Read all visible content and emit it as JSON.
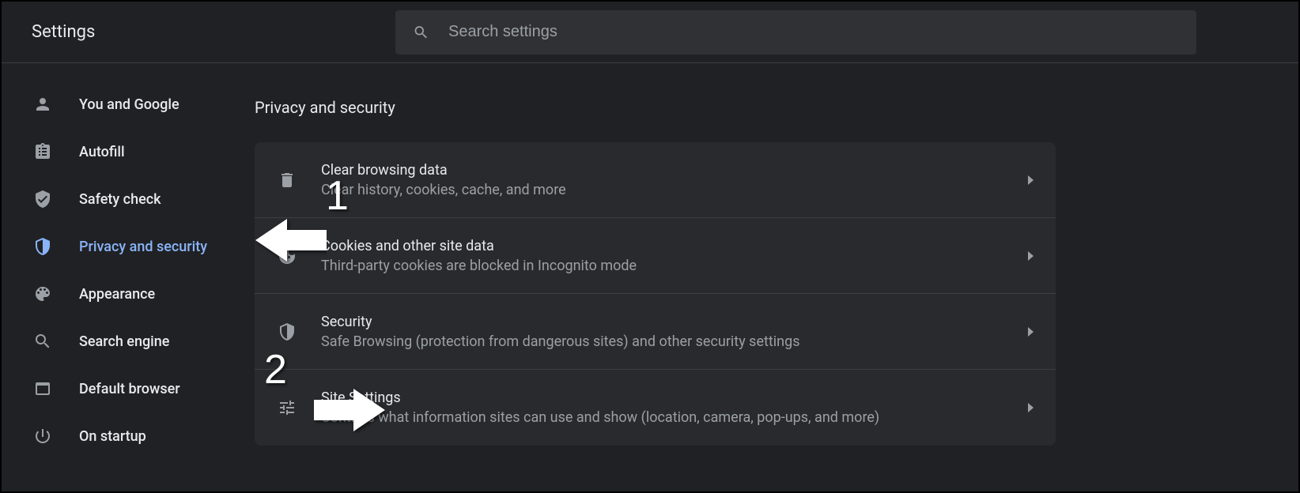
{
  "header": {
    "title": "Settings",
    "search_placeholder": "Search settings"
  },
  "sidebar": {
    "items": [
      {
        "id": "you-and-google",
        "label": "You and Google",
        "icon": "person-icon",
        "active": false
      },
      {
        "id": "autofill",
        "label": "Autofill",
        "icon": "clipboard-icon",
        "active": false
      },
      {
        "id": "safety-check",
        "label": "Safety check",
        "icon": "shield-check-icon",
        "active": false
      },
      {
        "id": "privacy-and-security",
        "label": "Privacy and security",
        "icon": "shield-icon",
        "active": true
      },
      {
        "id": "appearance",
        "label": "Appearance",
        "icon": "palette-icon",
        "active": false
      },
      {
        "id": "search-engine",
        "label": "Search engine",
        "icon": "search-icon",
        "active": false
      },
      {
        "id": "default-browser",
        "label": "Default browser",
        "icon": "browser-icon",
        "active": false
      },
      {
        "id": "on-startup",
        "label": "On startup",
        "icon": "power-icon",
        "active": false
      }
    ]
  },
  "main": {
    "section_title": "Privacy and security",
    "items": [
      {
        "id": "clear-browsing-data",
        "icon": "trash-icon",
        "title": "Clear browsing data",
        "subtitle": "Clear history, cookies, cache, and more"
      },
      {
        "id": "cookies",
        "icon": "cookie-icon",
        "title": "Cookies and other site data",
        "subtitle": "Third-party cookies are blocked in Incognito mode"
      },
      {
        "id": "security",
        "icon": "shield-icon",
        "title": "Security",
        "subtitle": "Safe Browsing (protection from dangerous sites) and other security settings"
      },
      {
        "id": "site-settings",
        "icon": "tune-icon",
        "title": "Site Settings",
        "subtitle": "Controls what information sites can use and show (location, camera, pop-ups, and more)"
      }
    ]
  },
  "annotations": {
    "step1": "1",
    "step2": "2"
  }
}
